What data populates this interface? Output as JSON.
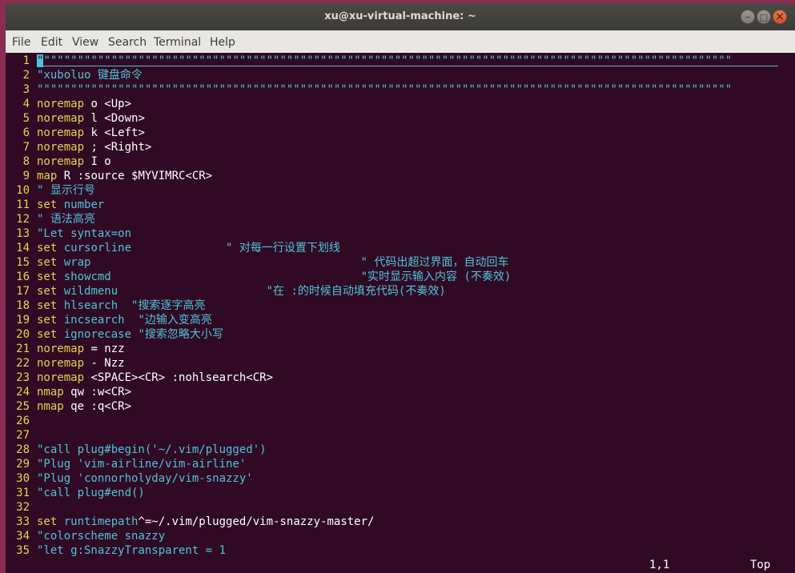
{
  "window": {
    "title": "xu@xu-virtual-machine: ~",
    "buttons": {
      "minimize": "–",
      "maximize": "□",
      "close": "×"
    }
  },
  "menubar": [
    "File",
    "Edit",
    "View",
    "Search",
    "Terminal",
    "Help"
  ],
  "lines": [
    {
      "n": "1",
      "segs": [
        {
          "c": "cursor",
          "t": "\""
        },
        {
          "c": "cm",
          "t": "\"\"\"\"\"\"\"\"\"\"\"\"\"\"\"\"\"\"\"\"\"\"\"\"\"\"\"\"\"\"\"\"\"\"\"\"\"\"\"\"\"\"\"\"\"\"\"\"\"\"\"\"\"\"\"\"\"\"\"\"\"\"\"\"\"\"\"\"\"\"\"\"\"\"\"\"\"\"\"\"\"\"\"\"\"\"\"\"\"\"\"\"\"\"\"\"\"\"\"\"\"\""
        }
      ]
    },
    {
      "n": "2",
      "segs": [
        {
          "c": "cm",
          "t": "\"xuboluo 键盘命令"
        }
      ]
    },
    {
      "n": "3",
      "segs": [
        {
          "c": "cm",
          "t": "\"\"\"\"\"\"\"\"\"\"\"\"\"\"\"\"\"\"\"\"\"\"\"\"\"\"\"\"\"\"\"\"\"\"\"\"\"\"\"\"\"\"\"\"\"\"\"\"\"\"\"\"\"\"\"\"\"\"\"\"\"\"\"\"\"\"\"\"\"\"\"\"\"\"\"\"\"\"\"\"\"\"\"\"\"\"\"\"\"\"\"\"\"\"\"\"\"\"\"\"\"\"\""
        }
      ]
    },
    {
      "n": "4",
      "segs": [
        {
          "c": "kw",
          "t": "noremap"
        },
        {
          "c": "plain",
          "t": " o <Up>"
        }
      ]
    },
    {
      "n": "5",
      "segs": [
        {
          "c": "kw",
          "t": "noremap"
        },
        {
          "c": "plain",
          "t": " l <Down>"
        }
      ]
    },
    {
      "n": "6",
      "segs": [
        {
          "c": "kw",
          "t": "noremap"
        },
        {
          "c": "plain",
          "t": " k <Left>"
        }
      ]
    },
    {
      "n": "7",
      "segs": [
        {
          "c": "kw",
          "t": "noremap"
        },
        {
          "c": "plain",
          "t": " ; <Right>"
        }
      ]
    },
    {
      "n": "8",
      "segs": [
        {
          "c": "kw",
          "t": "noremap"
        },
        {
          "c": "plain",
          "t": " I o"
        }
      ]
    },
    {
      "n": "9",
      "segs": [
        {
          "c": "kw",
          "t": "map"
        },
        {
          "c": "plain",
          "t": " R :source $MYVIMRC<CR>"
        }
      ]
    },
    {
      "n": "10",
      "segs": [
        {
          "c": "cm",
          "t": "\" 显示行号"
        }
      ]
    },
    {
      "n": "11",
      "segs": [
        {
          "c": "kw",
          "t": "set"
        },
        {
          "c": "plain",
          "t": " "
        },
        {
          "c": "opt",
          "t": "number"
        }
      ]
    },
    {
      "n": "12",
      "segs": [
        {
          "c": "cm",
          "t": "\" 语法高亮"
        }
      ]
    },
    {
      "n": "13",
      "segs": [
        {
          "c": "cm",
          "t": "\"Let syntax=on"
        }
      ]
    },
    {
      "n": "14",
      "segs": [
        {
          "c": "kw",
          "t": "set"
        },
        {
          "c": "plain",
          "t": " "
        },
        {
          "c": "opt",
          "t": "cursorline"
        },
        {
          "c": "plain",
          "t": "              "
        },
        {
          "c": "cm",
          "t": "\" 对每一行设置下划线"
        }
      ]
    },
    {
      "n": "15",
      "segs": [
        {
          "c": "kw",
          "t": "set"
        },
        {
          "c": "plain",
          "t": " "
        },
        {
          "c": "opt",
          "t": "wrap"
        },
        {
          "c": "plain",
          "t": "                                        "
        },
        {
          "c": "cm",
          "t": "\" 代码出超过界面，自动回车"
        }
      ]
    },
    {
      "n": "16",
      "segs": [
        {
          "c": "kw",
          "t": "set"
        },
        {
          "c": "plain",
          "t": " "
        },
        {
          "c": "opt",
          "t": "showcmd"
        },
        {
          "c": "plain",
          "t": "                                     "
        },
        {
          "c": "cm",
          "t": "\"实时显示输入内容 (不奏效)"
        }
      ]
    },
    {
      "n": "17",
      "segs": [
        {
          "c": "kw",
          "t": "set"
        },
        {
          "c": "plain",
          "t": " "
        },
        {
          "c": "opt",
          "t": "wildmenu"
        },
        {
          "c": "plain",
          "t": "                      "
        },
        {
          "c": "cm",
          "t": "\"在 :的时候自动填充代码(不奏效)"
        }
      ]
    },
    {
      "n": "18",
      "segs": [
        {
          "c": "kw",
          "t": "set"
        },
        {
          "c": "plain",
          "t": " "
        },
        {
          "c": "opt",
          "t": "hlsearch"
        },
        {
          "c": "plain",
          "t": "  "
        },
        {
          "c": "cm",
          "t": "\"搜索逐字高亮"
        }
      ]
    },
    {
      "n": "19",
      "segs": [
        {
          "c": "kw",
          "t": "set"
        },
        {
          "c": "plain",
          "t": " "
        },
        {
          "c": "opt",
          "t": "incsearch"
        },
        {
          "c": "plain",
          "t": "  "
        },
        {
          "c": "cm",
          "t": "\"边输入变高亮"
        }
      ]
    },
    {
      "n": "20",
      "segs": [
        {
          "c": "kw",
          "t": "set"
        },
        {
          "c": "plain",
          "t": " "
        },
        {
          "c": "opt",
          "t": "ignorecase"
        },
        {
          "c": "plain",
          "t": " "
        },
        {
          "c": "cm",
          "t": "\"搜索忽略大小写"
        }
      ]
    },
    {
      "n": "21",
      "segs": [
        {
          "c": "kw",
          "t": "noremap"
        },
        {
          "c": "plain",
          "t": " = nzz"
        }
      ]
    },
    {
      "n": "22",
      "segs": [
        {
          "c": "kw",
          "t": "noremap"
        },
        {
          "c": "plain",
          "t": " - Nzz"
        }
      ]
    },
    {
      "n": "23",
      "segs": [
        {
          "c": "kw",
          "t": "noremap"
        },
        {
          "c": "plain",
          "t": " <SPACE><CR> :nohlsearch<CR>"
        }
      ]
    },
    {
      "n": "24",
      "segs": [
        {
          "c": "kw",
          "t": "nmap"
        },
        {
          "c": "plain",
          "t": " qw :w<CR>"
        }
      ]
    },
    {
      "n": "25",
      "segs": [
        {
          "c": "kw",
          "t": "nmap"
        },
        {
          "c": "plain",
          "t": " qe :q<CR>"
        }
      ]
    },
    {
      "n": "26",
      "segs": []
    },
    {
      "n": "27",
      "segs": []
    },
    {
      "n": "28",
      "segs": [
        {
          "c": "cm",
          "t": "\"call plug#begin('~/.vim/plugged')"
        }
      ]
    },
    {
      "n": "29",
      "segs": [
        {
          "c": "cm",
          "t": "\"Plug 'vim-airline/vim-airline'"
        }
      ]
    },
    {
      "n": "30",
      "segs": [
        {
          "c": "cm",
          "t": "\"Plug 'connorholyday/vim-snazzy'"
        }
      ]
    },
    {
      "n": "31",
      "segs": [
        {
          "c": "cm",
          "t": "\"call plug#end()"
        }
      ]
    },
    {
      "n": "32",
      "segs": []
    },
    {
      "n": "33",
      "segs": [
        {
          "c": "kw",
          "t": "set"
        },
        {
          "c": "plain",
          "t": " "
        },
        {
          "c": "opt",
          "t": "runtimepath"
        },
        {
          "c": "plain",
          "t": "^=~/.vim/plugged/vim-snazzy-master/"
        }
      ]
    },
    {
      "n": "34",
      "segs": [
        {
          "c": "cm",
          "t": "\"colorscheme snazzy"
        }
      ]
    },
    {
      "n": "35",
      "segs": [
        {
          "c": "cm",
          "t": "\"let g:SnazzyTransparent = 1"
        }
      ]
    }
  ],
  "statusline": {
    "position": "1,1",
    "scroll": "Top"
  },
  "colors": {
    "terminal_bg": "#300a24",
    "line_number": "#e6d24e",
    "keyword": "#e6d24e",
    "comment": "#4fc3d6",
    "text": "#ffffff"
  }
}
